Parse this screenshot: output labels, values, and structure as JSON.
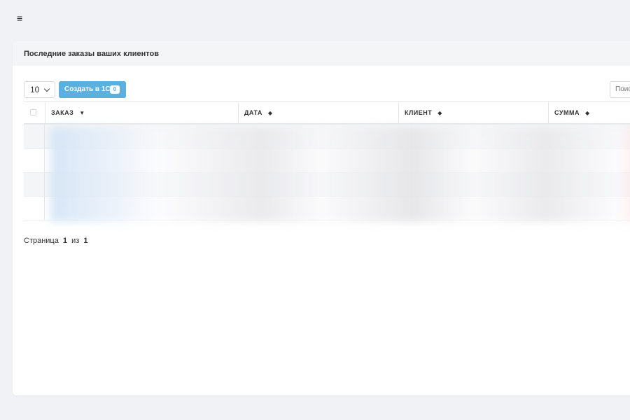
{
  "topbar": {
    "menu_icon": "hamburger-icon"
  },
  "card": {
    "title": "Последние заказы ваших клиентов"
  },
  "controls": {
    "page_length": "10",
    "create_button": "Создать в 1С",
    "create_count": "0",
    "search_placeholder": "Поис"
  },
  "table": {
    "columns": [
      "ЗАКАЗ",
      "ДАТА",
      "КЛИЕНТ",
      "СУММА"
    ],
    "sort_indicators": [
      "▼",
      "◆",
      "◆",
      "◆"
    ]
  },
  "pagination": {
    "prefix": "Страница",
    "current": "1",
    "separator": "из",
    "total": "1"
  },
  "colors": {
    "accent": "#5ab0df",
    "background": "#f0f2f5",
    "card": "#ffffff",
    "header": "#f4f5f7"
  }
}
